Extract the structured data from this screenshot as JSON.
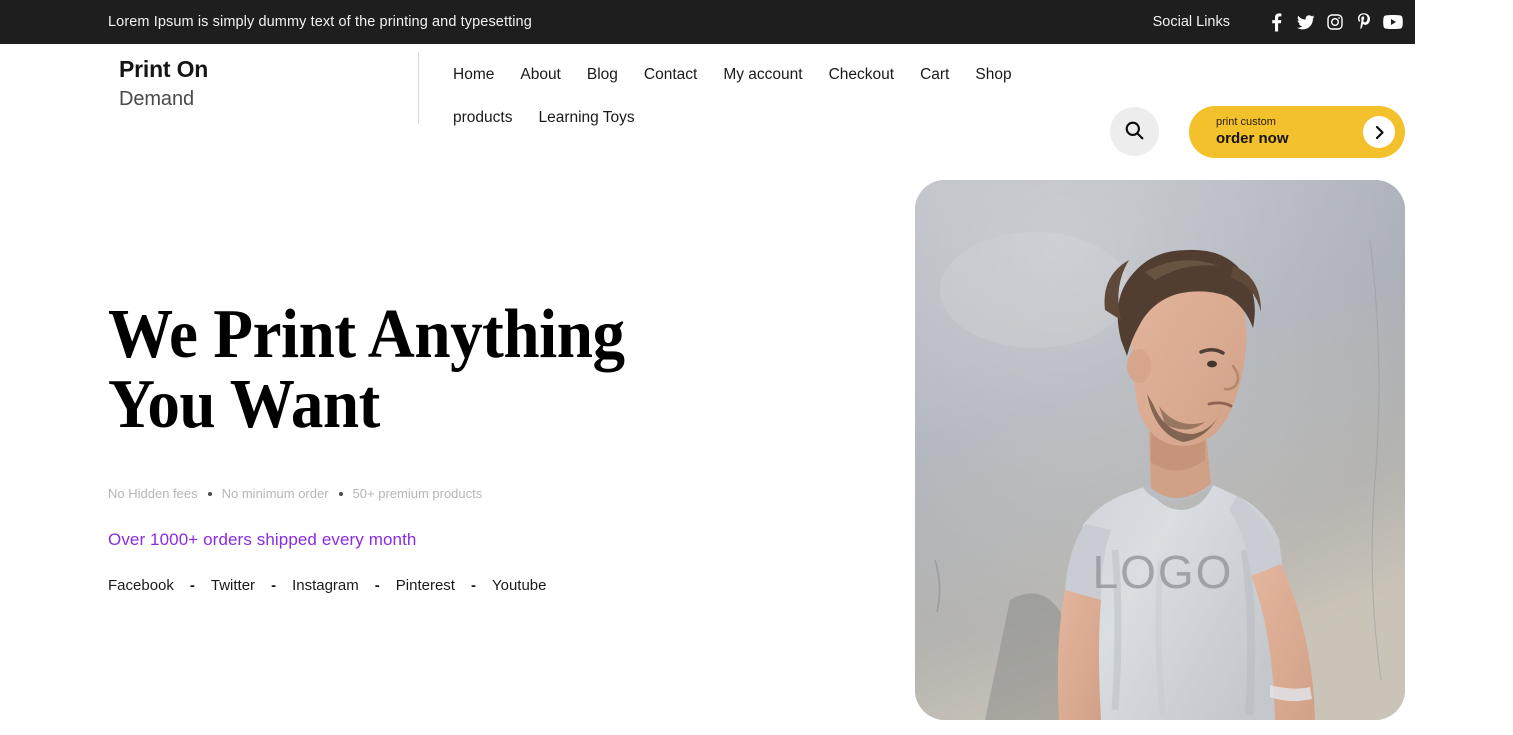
{
  "topbar": {
    "message": "Lorem Ipsum is simply dummy text of the printing and typesetting",
    "social_label": "Social Links",
    "icons": [
      {
        "name": "facebook-icon",
        "label": "Facebook"
      },
      {
        "name": "twitter-icon",
        "label": "Twitter"
      },
      {
        "name": "instagram-icon",
        "label": "Instagram"
      },
      {
        "name": "pinterest-icon",
        "label": "Pinterest"
      },
      {
        "name": "youtube-icon",
        "label": "YouTube"
      }
    ],
    "background_color": "#1e1e1e"
  },
  "header": {
    "logo": {
      "line1": "Print On",
      "line2": "Demand"
    },
    "nav": [
      {
        "label": "Home"
      },
      {
        "label": "About"
      },
      {
        "label": "Blog"
      },
      {
        "label": "Contact"
      },
      {
        "label": "My account"
      },
      {
        "label": "Checkout"
      },
      {
        "label": "Cart"
      },
      {
        "label": "Shop"
      },
      {
        "label": "products"
      },
      {
        "label": "Learning Toys"
      }
    ],
    "search": {
      "icon": "search-icon"
    },
    "cta": {
      "top_label": "print custom",
      "bottom_label": "order now",
      "arrow_icon": "chevron-right-icon",
      "background_color": "#f2c12c"
    }
  },
  "hero": {
    "title": "We Print Anything You Want",
    "features": [
      "No Hidden fees",
      "No minimum order",
      "50+ premium products"
    ],
    "subtitle": "Over 1000+ orders shipped every month",
    "subtitle_color": "#8a2be2",
    "socials": [
      {
        "label": "Facebook"
      },
      {
        "label": "Twitter"
      },
      {
        "label": "Instagram"
      },
      {
        "label": "Pinterest"
      },
      {
        "label": "Youtube"
      }
    ],
    "social_separator": "-",
    "image": {
      "alt": "Man in gray t-shirt with LOGO print standing against a light wall",
      "shirt_text": "LOGO"
    }
  }
}
